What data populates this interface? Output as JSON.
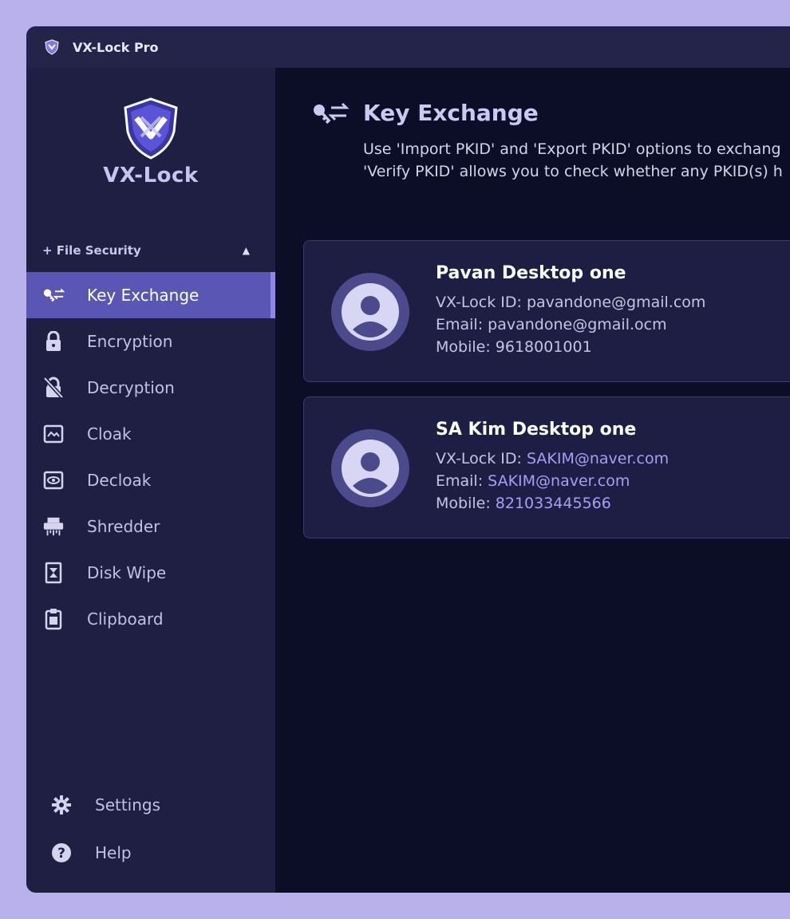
{
  "window": {
    "title": "VX-Lock Pro"
  },
  "sidebar": {
    "logo_text": "VX-Lock",
    "section_label": "+ File Security",
    "items": [
      {
        "label": "Key Exchange",
        "icon": "key-exchange-icon",
        "active": true
      },
      {
        "label": "Encryption",
        "icon": "lock-icon"
      },
      {
        "label": "Decryption",
        "icon": "unlock-icon"
      },
      {
        "label": "Cloak",
        "icon": "cloak-icon"
      },
      {
        "label": "Decloak",
        "icon": "eye-icon"
      },
      {
        "label": "Shredder",
        "icon": "shredder-icon"
      },
      {
        "label": "Disk Wipe",
        "icon": "disk-wipe-icon"
      },
      {
        "label": "Clipboard",
        "icon": "clipboard-icon"
      }
    ],
    "bottom_items": [
      {
        "label": "Settings",
        "icon": "gear-icon"
      },
      {
        "label": "Help",
        "icon": "help-icon"
      }
    ]
  },
  "main": {
    "title": "Key Exchange",
    "description": [
      "Use 'Import PKID' and 'Export PKID' options to exchang",
      "'Verify PKID' allows you to check whether any PKID(s) h"
    ],
    "contacts": [
      {
        "name": "Pavan Desktop one",
        "id_label": "VX-Lock ID: ",
        "id_value": "pavandone@gmail.com",
        "email_label": "Email: ",
        "email_value": "pavandone@gmail.ocm",
        "mobile_label": "Mobile: ",
        "mobile_value": "9618001001"
      },
      {
        "name": "SA Kim Desktop one",
        "id_label": "VX-Lock ID: ",
        "id_value": "SAKIM@naver.com",
        "email_label": "Email: ",
        "email_value": "SAKIM@naver.com",
        "mobile_label": "Mobile: ",
        "mobile_value": " 821033445566"
      }
    ]
  },
  "colors": {
    "accent": "#5a56b3",
    "highlight_text": "#a3a0f5",
    "background": "#0c0d26"
  }
}
